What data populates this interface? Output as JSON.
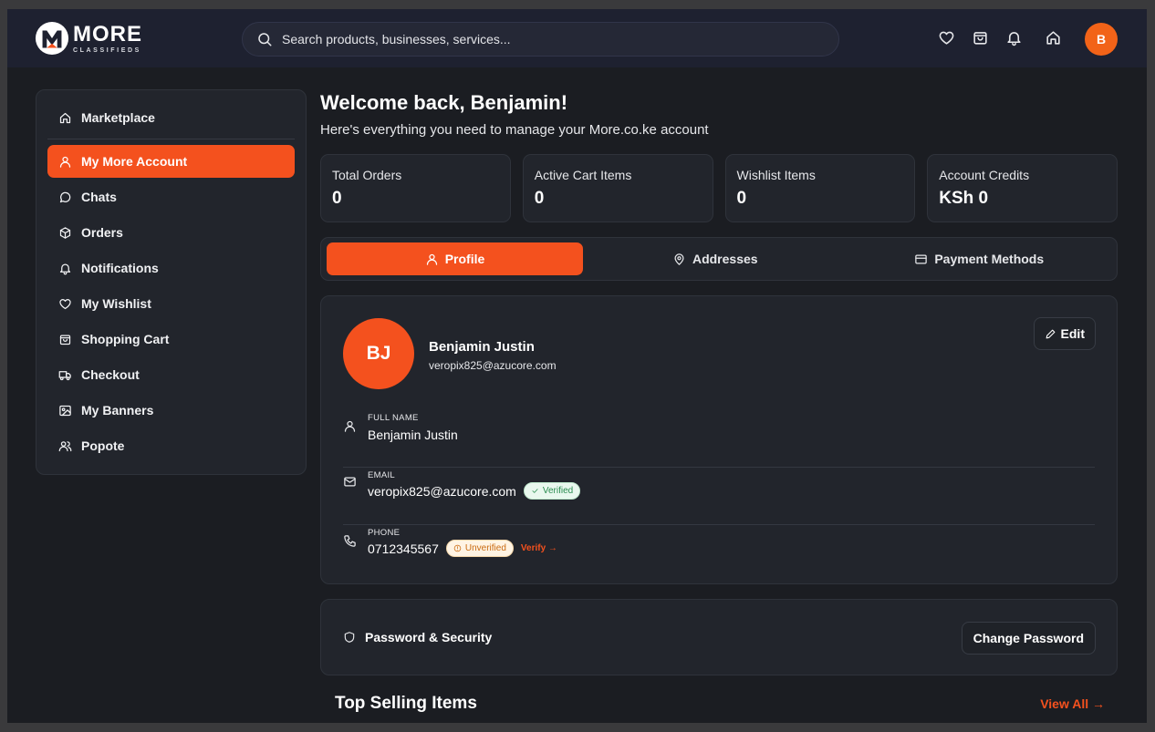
{
  "brand": {
    "name": "MORE",
    "tagline": "CLASSIFIEDS",
    "accent": "#f4511e"
  },
  "search": {
    "placeholder": "Search products, businesses, services..."
  },
  "header": {
    "icons": [
      "heart-icon",
      "bag-icon",
      "bell-icon",
      "home-icon"
    ],
    "avatar_initial": "B"
  },
  "sidebar": {
    "items": [
      {
        "label": "Marketplace",
        "icon": "home-icon"
      },
      {
        "label": "My More Account",
        "icon": "user-icon",
        "active": true
      },
      {
        "label": "Chats",
        "icon": "chat-icon"
      },
      {
        "label": "Orders",
        "icon": "box-icon"
      },
      {
        "label": "Notifications",
        "icon": "bell-icon"
      },
      {
        "label": "My Wishlist",
        "icon": "heart-icon"
      },
      {
        "label": "Shopping Cart",
        "icon": "bag-icon"
      },
      {
        "label": "Checkout",
        "icon": "truck-icon"
      },
      {
        "label": "My Banners",
        "icon": "image-icon"
      },
      {
        "label": "Popote",
        "icon": "users-icon"
      }
    ]
  },
  "welcome": {
    "title": "Welcome back, Benjamin!",
    "subtitle": "Here's everything you need to manage your More.co.ke account"
  },
  "stats": [
    {
      "label": "Total Orders",
      "value": "0"
    },
    {
      "label": "Active Cart Items",
      "value": "0"
    },
    {
      "label": "Wishlist Items",
      "value": "0"
    },
    {
      "label": "Account Credits",
      "value": "KSh 0"
    }
  ],
  "tabs": [
    {
      "label": "Profile",
      "active": true
    },
    {
      "label": "Addresses"
    },
    {
      "label": "Payment Methods"
    }
  ],
  "profile": {
    "initials": "BJ",
    "name": "Benjamin Justin",
    "email": "veropix825@azucore.com",
    "edit_label": "Edit",
    "fields": {
      "full_name": {
        "label": "FULL NAME",
        "value": "Benjamin Justin"
      },
      "email": {
        "label": "EMAIL",
        "value": "veropix825@azucore.com",
        "badge": "Verified"
      },
      "phone": {
        "label": "PHONE",
        "value": "0712345567",
        "badge": "Unverified",
        "action": "Verify →"
      }
    }
  },
  "security": {
    "title": "Password & Security",
    "button": "Change Password"
  },
  "top_selling": {
    "title": "Top Selling Items",
    "link": "View All →"
  }
}
